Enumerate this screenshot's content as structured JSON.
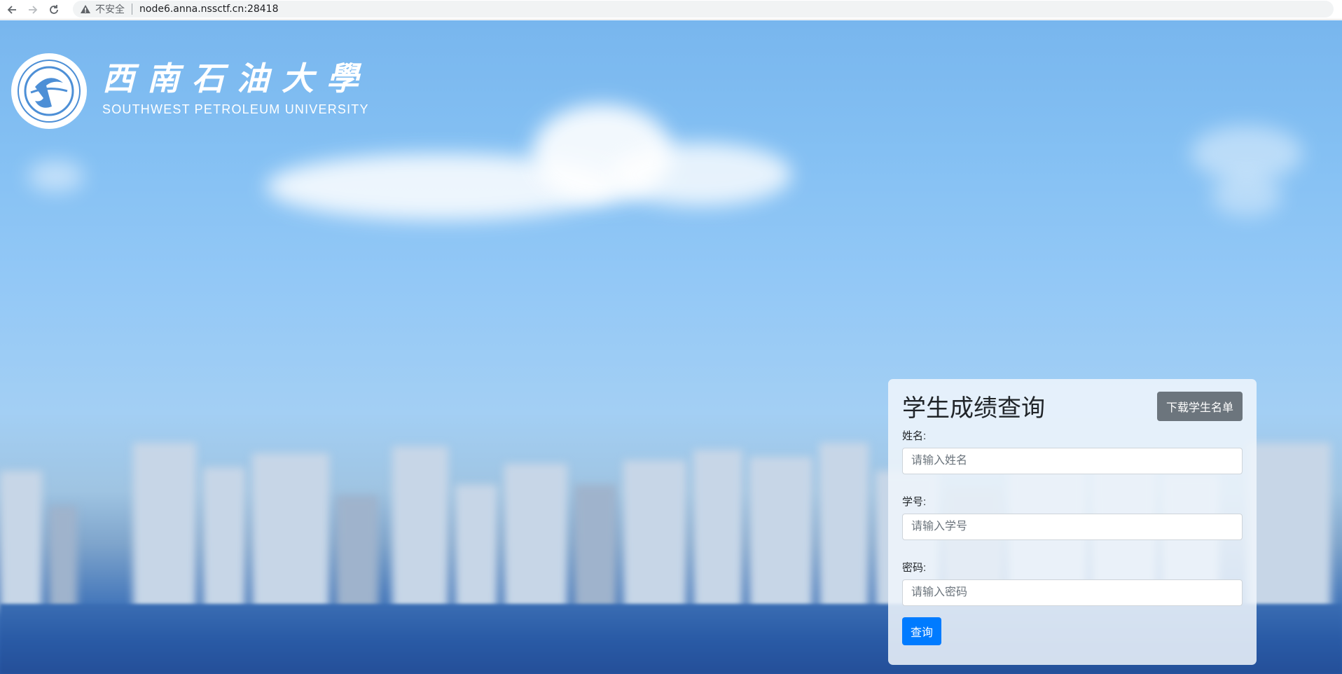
{
  "browser": {
    "insecure_label": "不安全",
    "url": "node6.anna.nssctf.cn:28418",
    "back_icon": "arrow-left-icon",
    "forward_icon": "arrow-right-icon",
    "reload_icon": "reload-icon",
    "warning_icon": "warning-triangle-icon"
  },
  "logo": {
    "name_cn": "西南石油大學",
    "name_en": "SOUTHWEST PETROLEUM UNIVERSITY"
  },
  "form": {
    "title": "学生成绩查询",
    "download_button": "下载学生名单",
    "fields": [
      {
        "label": "姓名:",
        "placeholder": "请输入姓名"
      },
      {
        "label": "学号:",
        "placeholder": "请输入学号"
      },
      {
        "label": "密码:",
        "placeholder": "请输入密码"
      }
    ],
    "submit_button": "查询"
  },
  "colors": {
    "primary": "#007bff",
    "secondary": "#6c757d"
  }
}
